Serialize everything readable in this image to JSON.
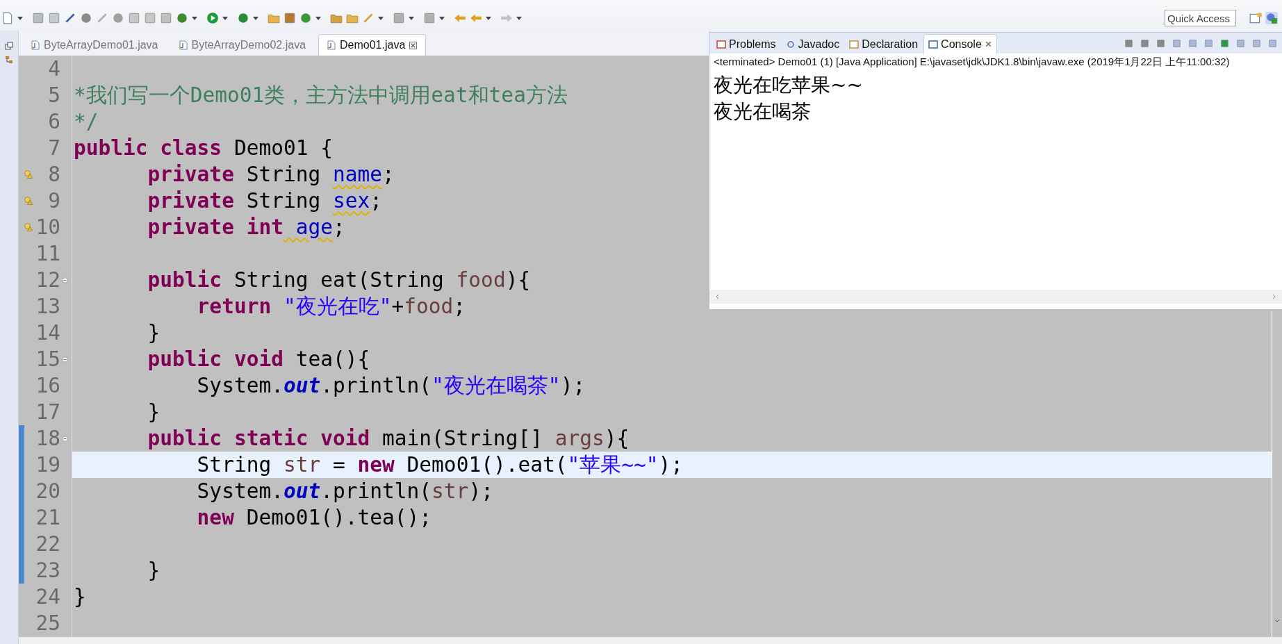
{
  "quick_access": {
    "placeholder": "Quick Access"
  },
  "editor_tabs": [
    {
      "label": "ByteArrayDemo01.java",
      "selected": false
    },
    {
      "label": "ByteArrayDemo02.java",
      "selected": false
    },
    {
      "label": "Demo01.java",
      "selected": true
    }
  ],
  "code_lines": [
    {
      "number": "4",
      "warning": false,
      "fold": false,
      "current": false,
      "changed": false
    },
    {
      "number": "5",
      "warning": false,
      "fold": false,
      "current": false,
      "changed": false,
      "tokens": [
        {
          "text": "*我们写一个Demo01类，主方法中调用eat和tea方法",
          "kind": "comment"
        }
      ]
    },
    {
      "number": "6",
      "warning": false,
      "fold": false,
      "current": false,
      "changed": false,
      "tokens": [
        {
          "text": "*/",
          "kind": "comment"
        }
      ]
    },
    {
      "number": "7",
      "warning": false,
      "fold": false,
      "current": false,
      "changed": false,
      "tokens": [
        {
          "text": "public class",
          "kind": "keyword"
        },
        {
          "text": " Demo01 {",
          "kind": "plain"
        }
      ]
    },
    {
      "number": "8",
      "warning": true,
      "fold": false,
      "current": false,
      "changed": false,
      "tokens": [
        {
          "text": "      private",
          "kind": "keyword"
        },
        {
          "text": " String ",
          "kind": "plain"
        },
        {
          "text": "name",
          "kind": "field"
        },
        {
          "text": ";",
          "kind": "plain"
        }
      ]
    },
    {
      "number": "9",
      "warning": true,
      "fold": false,
      "current": false,
      "changed": false,
      "tokens": [
        {
          "text": "      private",
          "kind": "keyword"
        },
        {
          "text": " String ",
          "kind": "plain"
        },
        {
          "text": "sex",
          "kind": "field"
        },
        {
          "text": ";",
          "kind": "plain"
        }
      ]
    },
    {
      "number": "10",
      "warning": true,
      "fold": false,
      "current": false,
      "changed": false,
      "tokens": [
        {
          "text": "      private int",
          "kind": "keyword"
        },
        {
          "text": " age",
          "kind": "field"
        },
        {
          "text": ";",
          "kind": "plain"
        }
      ]
    },
    {
      "number": "11",
      "warning": false,
      "fold": false,
      "current": false,
      "changed": false
    },
    {
      "number": "12",
      "warning": false,
      "fold": true,
      "current": false,
      "changed": false,
      "tokens": [
        {
          "text": "      public",
          "kind": "keyword"
        },
        {
          "text": " String eat(String ",
          "kind": "plain"
        },
        {
          "text": "food",
          "kind": "variable"
        },
        {
          "text": "){",
          "kind": "plain"
        }
      ]
    },
    {
      "number": "13",
      "warning": false,
      "fold": false,
      "current": false,
      "changed": false,
      "tokens": [
        {
          "text": "          return",
          "kind": "keyword"
        },
        {
          "text": " \"夜光在吃\"",
          "kind": "string"
        },
        {
          "text": "+",
          "kind": "plain"
        },
        {
          "text": "food",
          "kind": "variable"
        },
        {
          "text": ";",
          "kind": "plain"
        }
      ]
    },
    {
      "number": "14",
      "warning": false,
      "fold": false,
      "current": false,
      "changed": false,
      "tokens": [
        {
          "text": "      }",
          "kind": "plain"
        }
      ]
    },
    {
      "number": "15",
      "warning": false,
      "fold": true,
      "current": false,
      "changed": false,
      "tokens": [
        {
          "text": "      public void",
          "kind": "keyword"
        },
        {
          "text": " tea(){",
          "kind": "plain"
        }
      ]
    },
    {
      "number": "16",
      "warning": false,
      "fold": false,
      "current": false,
      "changed": false,
      "tokens": [
        {
          "text": "          System.",
          "kind": "plain"
        },
        {
          "text": "out",
          "kind": "static-field"
        },
        {
          "text": ".println(",
          "kind": "plain"
        },
        {
          "text": "\"夜光在喝茶\"",
          "kind": "string"
        },
        {
          "text": ");",
          "kind": "plain"
        }
      ]
    },
    {
      "number": "17",
      "warning": false,
      "fold": false,
      "current": false,
      "changed": false,
      "tokens": [
        {
          "text": "      }",
          "kind": "plain"
        }
      ]
    },
    {
      "number": "18",
      "warning": false,
      "fold": true,
      "current": false,
      "changed": true,
      "tokens": [
        {
          "text": "      public static void",
          "kind": "keyword"
        },
        {
          "text": " main(String[] ",
          "kind": "plain"
        },
        {
          "text": "args",
          "kind": "variable"
        },
        {
          "text": "){",
          "kind": "plain"
        }
      ]
    },
    {
      "number": "19",
      "warning": false,
      "fold": false,
      "current": true,
      "changed": true,
      "tokens": [
        {
          "text": "          String ",
          "kind": "plain"
        },
        {
          "text": "str",
          "kind": "variable"
        },
        {
          "text": " = ",
          "kind": "plain"
        },
        {
          "text": "new",
          "kind": "keyword"
        },
        {
          "text": " Demo01().eat(",
          "kind": "plain"
        },
        {
          "text": "\"苹果~~\"",
          "kind": "string"
        },
        {
          "text": ");",
          "kind": "plain"
        }
      ]
    },
    {
      "number": "20",
      "warning": false,
      "fold": false,
      "current": false,
      "changed": true,
      "tokens": [
        {
          "text": "          System.",
          "kind": "plain"
        },
        {
          "text": "out",
          "kind": "static-field"
        },
        {
          "text": ".println(",
          "kind": "plain"
        },
        {
          "text": "str",
          "kind": "variable"
        },
        {
          "text": ");",
          "kind": "plain"
        }
      ]
    },
    {
      "number": "21",
      "warning": false,
      "fold": false,
      "current": false,
      "changed": true,
      "tokens": [
        {
          "text": "          new",
          "kind": "keyword"
        },
        {
          "text": " Demo01().tea();",
          "kind": "plain"
        }
      ]
    },
    {
      "number": "22",
      "warning": false,
      "fold": false,
      "current": false,
      "changed": true
    },
    {
      "number": "23",
      "warning": false,
      "fold": false,
      "current": false,
      "changed": true,
      "tokens": [
        {
          "text": "      }",
          "kind": "plain"
        }
      ]
    },
    {
      "number": "24",
      "warning": false,
      "fold": false,
      "current": false,
      "changed": false,
      "tokens": [
        {
          "text": "}",
          "kind": "plain"
        }
      ]
    },
    {
      "number": "25",
      "warning": false,
      "fold": false,
      "current": false,
      "changed": false
    }
  ],
  "console": {
    "tabs": [
      {
        "label": "Problems",
        "selected": false
      },
      {
        "label": "Javadoc",
        "selected": false
      },
      {
        "label": "Declaration",
        "selected": false
      },
      {
        "label": "Console",
        "selected": true
      }
    ],
    "status": "<terminated> Demo01 (1) [Java Application] E:\\javaset\\jdk\\JDK1.8\\bin\\javaw.exe (2019年1月22日 上午11:00:32)",
    "output": [
      "夜光在吃苹果~~",
      "夜光在喝茶"
    ]
  }
}
